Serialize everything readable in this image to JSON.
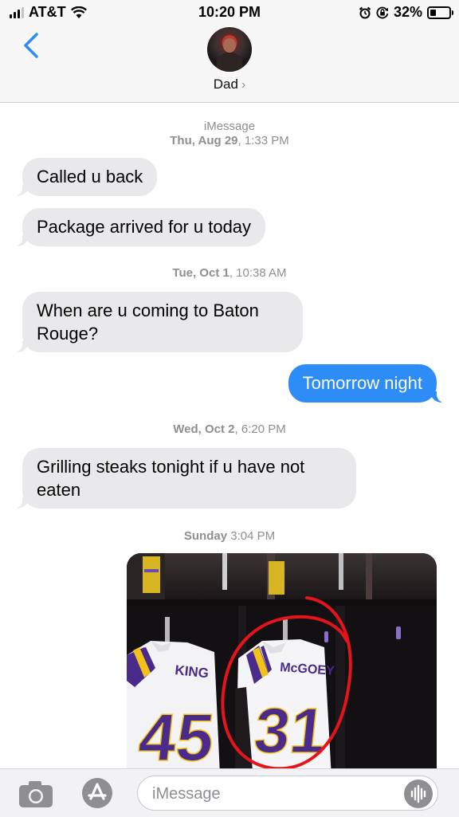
{
  "status_bar": {
    "carrier": "AT&T",
    "time": "10:20 PM",
    "battery": "32%",
    "battery_level": 0.32,
    "icons": [
      "signal-icon",
      "wifi-icon",
      "alarm-icon",
      "rotation-lock-icon",
      "battery-icon"
    ]
  },
  "header": {
    "contact_name": "Dad",
    "chevron": "›"
  },
  "messages": [
    {
      "kind": "meta",
      "service": "iMessage",
      "day": "Thu, Aug 29",
      "time": "1:33 PM"
    },
    {
      "kind": "in",
      "text": "Called u back"
    },
    {
      "kind": "in",
      "text": "Package arrived for u today"
    },
    {
      "kind": "meta",
      "day": "Tue, Oct 1",
      "time": "10:38 AM"
    },
    {
      "kind": "in",
      "text": "When are u coming to Baton Rouge?"
    },
    {
      "kind": "out",
      "text": "Tomorrow night"
    },
    {
      "kind": "meta",
      "day": "Wed, Oct 2",
      "time": "6:20 PM"
    },
    {
      "kind": "in",
      "text": "Grilling steaks tonight if u have not eaten"
    },
    {
      "kind": "meta",
      "day": "Sunday",
      "time": "3:04 PM"
    },
    {
      "kind": "photo",
      "jerseys": [
        {
          "name": "KING",
          "number": "45"
        },
        {
          "name": "McGOEY",
          "number": "31"
        }
      ]
    }
  ],
  "input": {
    "placeholder": "iMessage"
  },
  "colors": {
    "accent": "#2d8cf5",
    "incoming_bubble": "#e9e9eb",
    "meta_text": "#8e8e93",
    "circle_annotation": "#e3141b",
    "jersey_purple": "#4a2a8a",
    "jersey_gold": "#f1c21a"
  }
}
